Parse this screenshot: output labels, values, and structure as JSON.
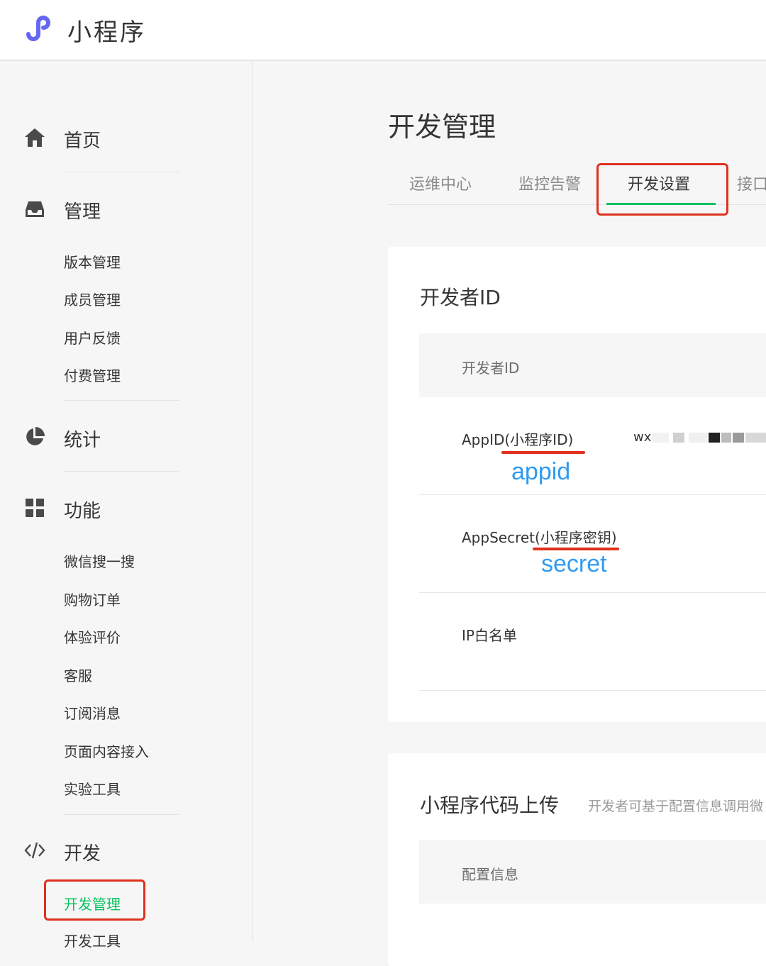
{
  "header": {
    "title": "小程序"
  },
  "sidebar": {
    "home": "首页",
    "manage": {
      "label": "管理",
      "items": [
        "版本管理",
        "成员管理",
        "用户反馈",
        "付费管理"
      ]
    },
    "stats": "统计",
    "features": {
      "label": "功能",
      "items": [
        "微信搜一搜",
        "购物订单",
        "体验评价",
        "客服",
        "订阅消息",
        "页面内容接入",
        "实验工具"
      ]
    },
    "dev": {
      "label": "开发",
      "items": [
        "开发管理",
        "开发工具"
      ],
      "active": "开发管理"
    }
  },
  "main": {
    "title": "开发管理",
    "tabs": [
      "运维中心",
      "监控告警",
      "开发设置",
      "接口"
    ],
    "active_tab": "开发设置",
    "dev_card": {
      "title": "开发者ID",
      "band_label": "开发者ID",
      "appid_label": "AppID(小程序ID)",
      "appid_value": "wx",
      "secret_label": "AppSecret(小程序密钥)",
      "ip_label": "IP白名单"
    },
    "upload_card": {
      "title": "小程序代码上传",
      "subtitle": "开发者可基于配置信息调用微",
      "band_label": "配置信息"
    }
  },
  "annotations": {
    "appid": "appid",
    "secret": "secret"
  },
  "colors": {
    "accent": "#07c160",
    "highlight": "#e0301e",
    "annotation": "#2f9bf3",
    "logo": "#6467f0"
  }
}
